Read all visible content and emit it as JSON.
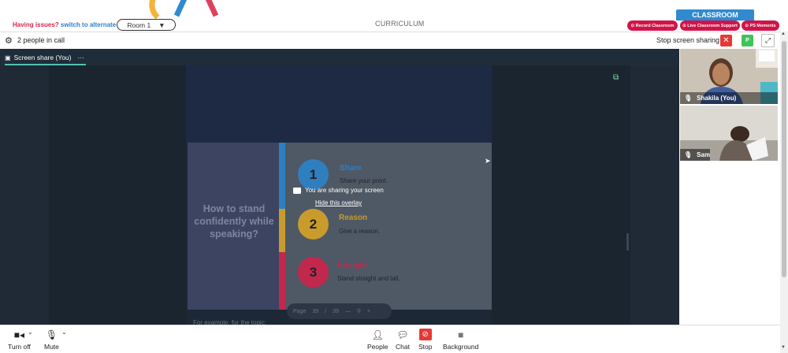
{
  "banner": {
    "issues_text": "Having issues?",
    "alt_text": "switch to alternate room",
    "room_label": "Room 1",
    "curriculum": "CURRICULUM",
    "classroom": "CLASSROOM",
    "record": "Record Classroom",
    "live_support": "Live Classroom Support",
    "ps_moments": "PS Moments"
  },
  "callbar": {
    "people": "2 people in call",
    "stop_sharing": "Stop screen sharing",
    "p_badge": "P"
  },
  "tab": {
    "label": "Screen share (You)",
    "more": "···"
  },
  "slide": {
    "title": "How to stand confidently while speaking?",
    "items": [
      {
        "num": "1",
        "heading": "Share",
        "desc": "Share your point."
      },
      {
        "num": "2",
        "heading": "Reason",
        "desc": "Give a reason."
      },
      {
        "num": "3",
        "heading": "Straight",
        "desc": "Stand straight and tall."
      }
    ],
    "overlay_msg": "You are sharing your screen",
    "overlay_hide": "Hide this overlay",
    "page_label": "Page",
    "page_current": "39",
    "page_sep": "/",
    "page_total": "39",
    "subtext": "For example, for the topic:"
  },
  "videos": [
    {
      "name": "Shakila (You)"
    },
    {
      "name": "Sam"
    }
  ],
  "toolbar": {
    "turn_off": "Turn off",
    "mute": "Mute",
    "people": "People",
    "chat": "Chat",
    "stop": "Stop",
    "background": "Background"
  },
  "colors": {
    "accent_red": "#d0144a",
    "brand_blue": "#2f8ad0",
    "share_blue": "#2f7fbf",
    "reason_yellow": "#c89b2c",
    "straight_red": "#c2284d"
  }
}
